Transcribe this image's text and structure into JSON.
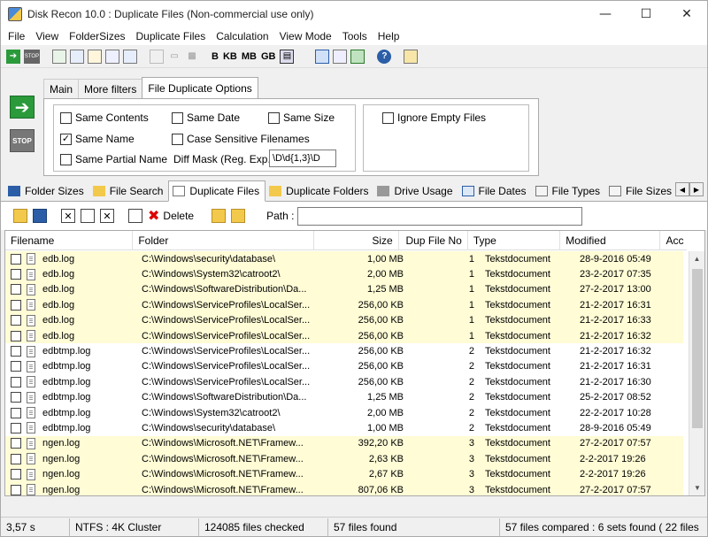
{
  "window": {
    "title": "Disk Recon 10.0 : Duplicate Files  (Non-commercial use only)",
    "minimize_icon": "minimize-icon",
    "maximize_icon": "maximize-icon",
    "close_icon": "close-icon"
  },
  "menu": [
    "File",
    "View",
    "FolderSizes",
    "Duplicate Files",
    "Calculation",
    "View Mode",
    "Tools",
    "Help"
  ],
  "toolbar": {
    "units": [
      "B",
      "KB",
      "MB",
      "GB"
    ]
  },
  "side": {
    "go_icon": "go-arrow-icon",
    "stop_label": "STOP"
  },
  "options": {
    "tabs": [
      "Main",
      "More filters",
      "File Duplicate Options"
    ],
    "active_tab": 2,
    "same_contents": "Same Contents",
    "same_date": "Same Date",
    "same_size": "Same Size",
    "same_name": "Same Name",
    "case_sensitive": "Case Sensitive Filenames",
    "same_partial_name": "Same Partial Name",
    "diff_mask_label": "Diff Mask (Reg. Exp.)",
    "diff_mask_value": "\\D\\d{1,3}\\D",
    "ignore_empty": "Ignore Empty Files",
    "checked": {
      "same_contents": false,
      "same_date": false,
      "same_size": false,
      "same_name": true,
      "case_sensitive": false,
      "same_partial_name": false,
      "ignore_empty": false
    }
  },
  "main_tabs": [
    "Folder Sizes",
    "File Search",
    "Duplicate Files",
    "Duplicate Folders",
    "Drive Usage",
    "File Dates",
    "File Types",
    "File Sizes"
  ],
  "main_active_tab": 2,
  "files_toolbar": {
    "delete_label": "Delete",
    "path_label": "Path :",
    "path_value": ""
  },
  "table": {
    "columns": [
      "Filename",
      "Folder",
      "Size",
      "Dup File No",
      "Type",
      "Modified",
      "Acc"
    ],
    "rows": [
      {
        "name": "edb.log",
        "folder": "C:\\Windows\\security\\database\\",
        "size": "1,00 MB",
        "dup": "1",
        "type": "Tekstdocument",
        "modified": "28-9-2016 05:49",
        "hl": true
      },
      {
        "name": "edb.log",
        "folder": "C:\\Windows\\System32\\catroot2\\",
        "size": "2,00 MB",
        "dup": "1",
        "type": "Tekstdocument",
        "modified": "23-2-2017 07:35",
        "hl": true
      },
      {
        "name": "edb.log",
        "folder": "C:\\Windows\\SoftwareDistribution\\Da...",
        "size": "1,25 MB",
        "dup": "1",
        "type": "Tekstdocument",
        "modified": "27-2-2017 13:00",
        "hl": true
      },
      {
        "name": "edb.log",
        "folder": "C:\\Windows\\ServiceProfiles\\LocalSer...",
        "size": "256,00 KB",
        "dup": "1",
        "type": "Tekstdocument",
        "modified": "21-2-2017 16:31",
        "hl": true
      },
      {
        "name": "edb.log",
        "folder": "C:\\Windows\\ServiceProfiles\\LocalSer...",
        "size": "256,00 KB",
        "dup": "1",
        "type": "Tekstdocument",
        "modified": "21-2-2017 16:33",
        "hl": true
      },
      {
        "name": "edb.log",
        "folder": "C:\\Windows\\ServiceProfiles\\LocalSer...",
        "size": "256,00 KB",
        "dup": "1",
        "type": "Tekstdocument",
        "modified": "21-2-2017 16:32",
        "hl": true
      },
      {
        "name": "edbtmp.log",
        "folder": "C:\\Windows\\ServiceProfiles\\LocalSer...",
        "size": "256,00 KB",
        "dup": "2",
        "type": "Tekstdocument",
        "modified": "21-2-2017 16:32",
        "hl": false
      },
      {
        "name": "edbtmp.log",
        "folder": "C:\\Windows\\ServiceProfiles\\LocalSer...",
        "size": "256,00 KB",
        "dup": "2",
        "type": "Tekstdocument",
        "modified": "21-2-2017 16:31",
        "hl": false
      },
      {
        "name": "edbtmp.log",
        "folder": "C:\\Windows\\ServiceProfiles\\LocalSer...",
        "size": "256,00 KB",
        "dup": "2",
        "type": "Tekstdocument",
        "modified": "21-2-2017 16:30",
        "hl": false
      },
      {
        "name": "edbtmp.log",
        "folder": "C:\\Windows\\SoftwareDistribution\\Da...",
        "size": "1,25 MB",
        "dup": "2",
        "type": "Tekstdocument",
        "modified": "25-2-2017 08:52",
        "hl": false
      },
      {
        "name": "edbtmp.log",
        "folder": "C:\\Windows\\System32\\catroot2\\",
        "size": "2,00 MB",
        "dup": "2",
        "type": "Tekstdocument",
        "modified": "22-2-2017 10:28",
        "hl": false
      },
      {
        "name": "edbtmp.log",
        "folder": "C:\\Windows\\security\\database\\",
        "size": "1,00 MB",
        "dup": "2",
        "type": "Tekstdocument",
        "modified": "28-9-2016 05:49",
        "hl": false
      },
      {
        "name": "ngen.log",
        "folder": "C:\\Windows\\Microsoft.NET\\Framew...",
        "size": "392,20 KB",
        "dup": "3",
        "type": "Tekstdocument",
        "modified": "27-2-2017 07:57",
        "hl": true
      },
      {
        "name": "ngen.log",
        "folder": "C:\\Windows\\Microsoft.NET\\Framew...",
        "size": "2,63 KB",
        "dup": "3",
        "type": "Tekstdocument",
        "modified": "2-2-2017 19:26",
        "hl": true
      },
      {
        "name": "ngen.log",
        "folder": "C:\\Windows\\Microsoft.NET\\Framew...",
        "size": "2,67 KB",
        "dup": "3",
        "type": "Tekstdocument",
        "modified": "2-2-2017 19:26",
        "hl": true
      },
      {
        "name": "ngen.log",
        "folder": "C:\\Windows\\Microsoft.NET\\Framew...",
        "size": "807,06 KB",
        "dup": "3",
        "type": "Tekstdocument",
        "modified": "27-2-2017 07:57",
        "hl": true
      }
    ]
  },
  "status": {
    "time": "3,57 s",
    "fs": "NTFS : 4K Cluster",
    "checked": "124085 files checked",
    "found": "57 files found",
    "compared": "57 files compared : 6 sets found ( 22 files"
  },
  "colors": {
    "row_highlight": "#fffcd6",
    "delete_red": "#d00000",
    "go_green": "#2a9a3a"
  }
}
